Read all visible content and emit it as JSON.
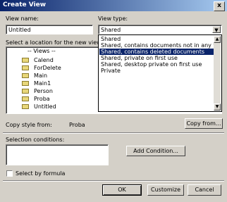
{
  "window": {
    "title": "Create View",
    "close_label": "x"
  },
  "view_name": {
    "label": "View name:",
    "value": "Untitled"
  },
  "view_type": {
    "label": "View type:",
    "selected": "Shared",
    "options": [
      "Shared",
      "Shared, contains documents not in any folders",
      "Shared, contains deleted documents",
      "Shared, private on first use",
      "Shared, desktop private on first use",
      "Private"
    ],
    "highlighted_index": 2
  },
  "location": {
    "label": "Select a location for the new view:",
    "header": "-- Views --",
    "items": [
      "Calend",
      "ForDelete",
      "Main",
      "Main1",
      "Person",
      "Proba",
      "Untitled"
    ]
  },
  "copy_style": {
    "label": "Copy style from:",
    "value": "Proba",
    "button": "Copy from..."
  },
  "selection": {
    "label": "Selection conditions:",
    "add_button": "Add Condition..."
  },
  "formula": {
    "label": "Select by formula",
    "checked": false
  },
  "buttons": {
    "ok": "OK",
    "customize": "Customize",
    "cancel": "Cancel"
  }
}
